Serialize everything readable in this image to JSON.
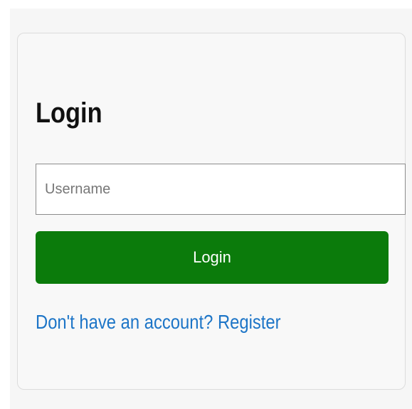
{
  "login": {
    "title": "Login",
    "username_placeholder": "Username",
    "username_value": "",
    "button_label": "Login",
    "register_link": "Don't have an account? Register"
  },
  "colors": {
    "page_background": "#f6f6f6",
    "card_background": "#f8f8f8",
    "button_green": "#0b7b0b",
    "link_blue": "#1d75c7"
  }
}
